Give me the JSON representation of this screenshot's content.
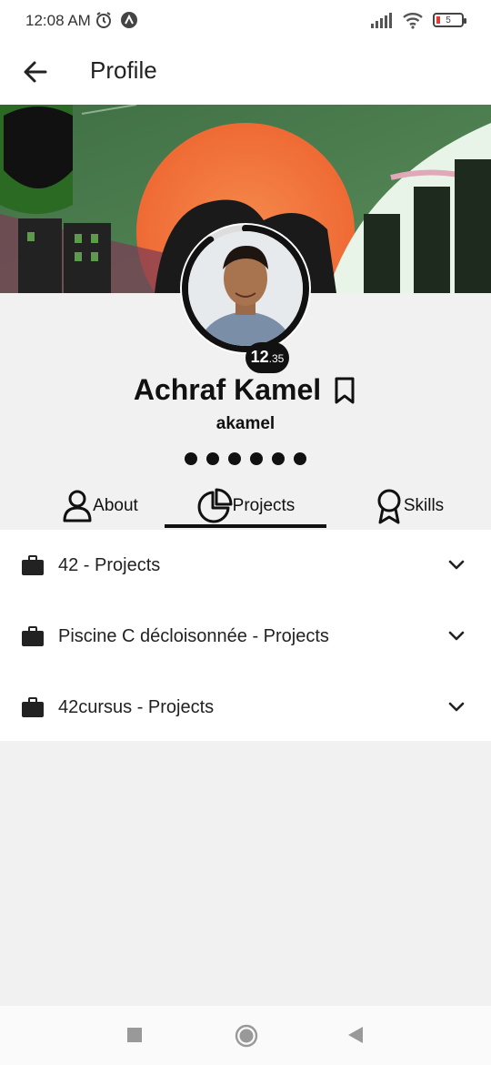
{
  "status_bar": {
    "time": "12:08 AM",
    "battery_level": "5",
    "icons": [
      "alarm-icon",
      "app-notification-icon",
      "signal-icon",
      "wifi-icon",
      "battery-icon"
    ]
  },
  "app_bar": {
    "title": "Profile",
    "back_icon": "arrow-left-icon"
  },
  "profile": {
    "full_name": "Achraf Kamel",
    "login": "akamel",
    "level_int": "12",
    "level_dec": ".35",
    "level_fraction": 0.35,
    "dots_count": 6
  },
  "tabs": [
    {
      "label": "About",
      "icon": "user-icon",
      "active": false
    },
    {
      "label": "Projects",
      "icon": "pie-chart-icon",
      "active": true
    },
    {
      "label": "Skills",
      "icon": "award-icon",
      "active": false
    }
  ],
  "projects": [
    {
      "label": "42 - Projects",
      "icon": "briefcase-icon"
    },
    {
      "label": "Piscine C décloisonnée - Projects",
      "icon": "briefcase-icon"
    },
    {
      "label": "42cursus - Projects",
      "icon": "briefcase-icon"
    }
  ],
  "colors": {
    "cover_green": "#4e7d4f",
    "sun_orange": "#f0703a",
    "accent_black": "#111111"
  },
  "nav_bar": {
    "buttons": [
      "recent-apps-icon",
      "home-icon",
      "back-triangle-icon"
    ]
  }
}
